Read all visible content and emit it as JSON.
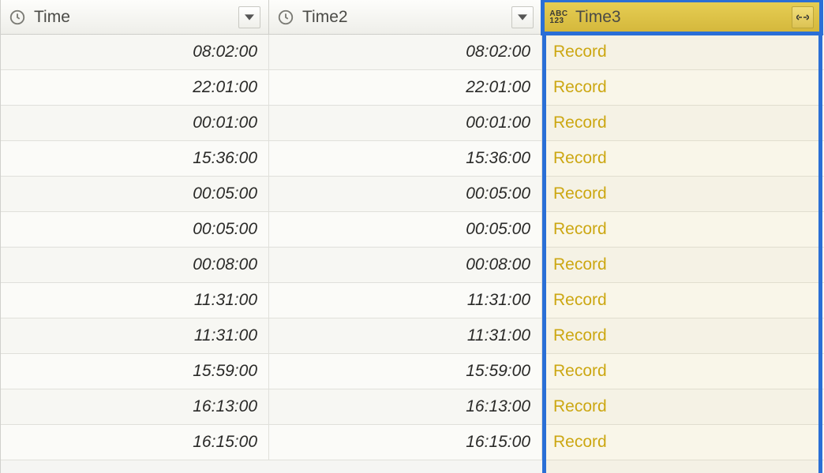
{
  "columns": {
    "c1": {
      "name": "Time",
      "type": "time"
    },
    "c2": {
      "name": "Time2",
      "type": "time"
    },
    "c3": {
      "name": "Time3",
      "type": "any",
      "selected": true
    }
  },
  "record_label": "Record",
  "rows": [
    {
      "time": "08:02:00",
      "time2": "08:02:00",
      "time3": "Record"
    },
    {
      "time": "22:01:00",
      "time2": "22:01:00",
      "time3": "Record"
    },
    {
      "time": "00:01:00",
      "time2": "00:01:00",
      "time3": "Record"
    },
    {
      "time": "15:36:00",
      "time2": "15:36:00",
      "time3": "Record"
    },
    {
      "time": "00:05:00",
      "time2": "00:05:00",
      "time3": "Record"
    },
    {
      "time": "00:05:00",
      "time2": "00:05:00",
      "time3": "Record"
    },
    {
      "time": "00:08:00",
      "time2": "00:08:00",
      "time3": "Record"
    },
    {
      "time": "11:31:00",
      "time2": "11:31:00",
      "time3": "Record"
    },
    {
      "time": "11:31:00",
      "time2": "11:31:00",
      "time3": "Record"
    },
    {
      "time": "15:59:00",
      "time2": "15:59:00",
      "time3": "Record"
    },
    {
      "time": "16:13:00",
      "time2": "16:13:00",
      "time3": "Record"
    },
    {
      "time": "16:15:00",
      "time2": "16:15:00",
      "time3": "Record"
    }
  ]
}
